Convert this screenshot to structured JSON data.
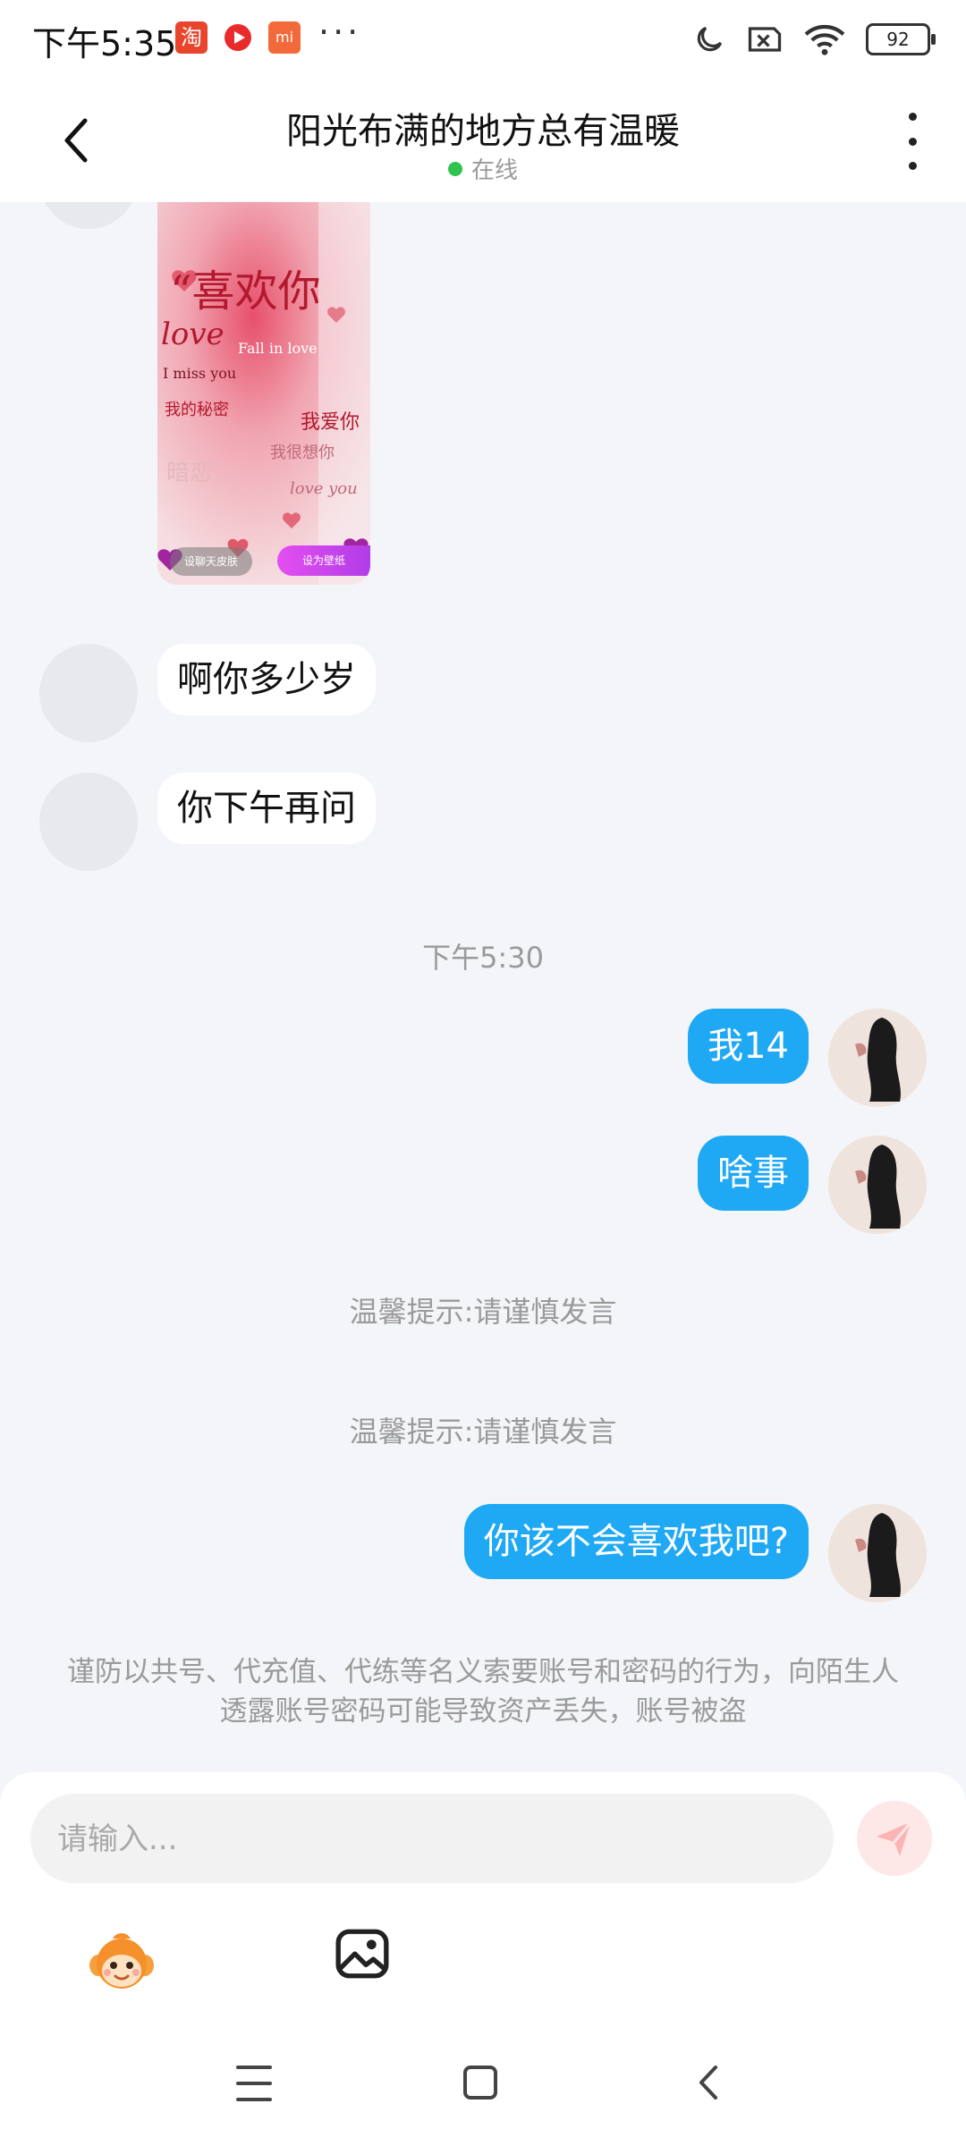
{
  "status_bar": {
    "time": "下午5:35",
    "app_icons": [
      "taobao-icon",
      "video-icon",
      "mi-icon"
    ],
    "overflow": "···",
    "battery": "92"
  },
  "header": {
    "title": "阳光布满的地方总有温暖",
    "status": "在线"
  },
  "image_card": {
    "heading": "“喜欢你",
    "lines": [
      "love",
      "Fall in love",
      "I miss you",
      "我的秘密",
      "我爱你",
      "暗恋",
      "我很想你",
      "love you"
    ],
    "button_left": "设聊天皮肤",
    "button_right": "设为壁纸"
  },
  "messages": {
    "left_1": "啊你多少岁",
    "left_2": "你下午再问",
    "time_1": "下午5:30",
    "right_1": "我14",
    "right_2": "啥事",
    "tip_1": "温馨提示:请谨慎发言",
    "tip_2": "温馨提示:请谨慎发言",
    "right_3": "你该不会喜欢我吧?"
  },
  "warning": "谨防以共号、代充值、代练等名义索要账号和密码的行为，向陌生人透露账号密码可能导致资产丢失，账号被盗",
  "input": {
    "placeholder": "请输入..."
  },
  "colors": {
    "accent_blue": "#1fa8f4",
    "online_green": "#2fc44c",
    "background": "#f3f5f8"
  }
}
